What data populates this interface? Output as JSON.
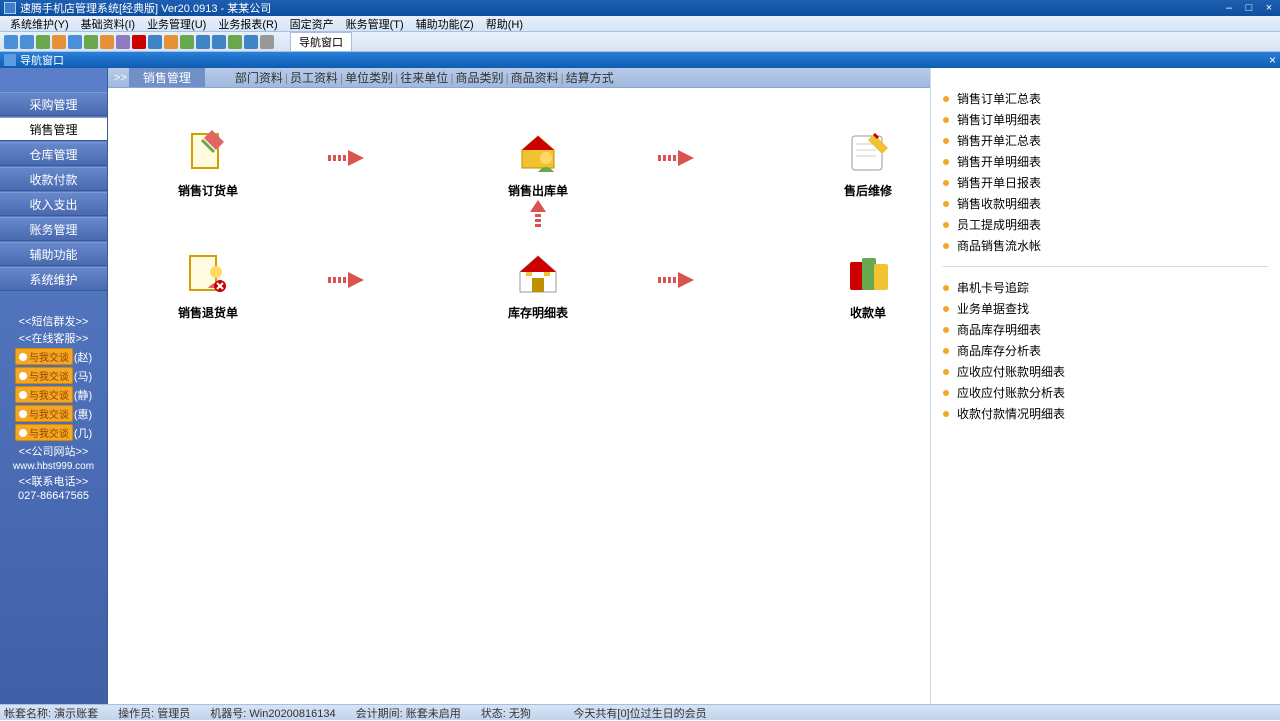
{
  "window": {
    "title": "速腾手机店管理系统[经典版] Ver20.0913  -  某某公司"
  },
  "menus": [
    "系统维护(Y)",
    "基础资料(I)",
    "业务管理(U)",
    "业务报表(R)",
    "固定资产",
    "账务管理(T)",
    "辅助功能(Z)",
    "帮助(H)"
  ],
  "toolbar_crumb": "导航窗口",
  "nav_header": "导航窗口",
  "sidebar": {
    "items": [
      "采购管理",
      "销售管理",
      "仓库管理",
      "收款付款",
      "收入支出",
      "账务管理",
      "辅助功能",
      "系统维护"
    ],
    "info": {
      "sms": "<<短信群发>>",
      "online": "<<在线客服>>",
      "chats": [
        "(赵)",
        "(马)",
        "(静)",
        "(惠)",
        "(几)"
      ],
      "chat_badge": "与我交谈",
      "website_title": "<<公司网站>>",
      "website": "www.hbst999.com",
      "phone_title": "<<联系电话>>",
      "phone": "027-86647565"
    }
  },
  "breadcrumb": {
    "title": "销售管理",
    "prefix": ">>",
    "links": [
      "部门资料",
      "员工资料",
      "单位类别",
      "往来单位",
      "商品类别",
      "商品资料",
      "结算方式"
    ]
  },
  "flow": {
    "row1": [
      "销售订货单",
      "销售出库单",
      "售后维修"
    ],
    "row2": [
      "销售退货单",
      "库存明细表",
      "收款单"
    ]
  },
  "right_panel": {
    "group1": [
      "销售订单汇总表",
      "销售订单明细表",
      "销售开单汇总表",
      "销售开单明细表",
      "销售开单日报表",
      "销售收款明细表",
      "员工提成明细表",
      "商品销售流水帐"
    ],
    "group2": [
      "串机卡号追踪",
      "业务单据查找",
      "商品库存明细表",
      "商品库存分析表",
      "应收应付账款明细表",
      "应收应付账款分析表",
      "收款付款情况明细表"
    ]
  },
  "status": {
    "account_label": "帐套名称:",
    "account": "演示账套",
    "operator_label": "操作员:",
    "operator": "管理员",
    "machine_label": "机器号:",
    "machine": "Win20200816134",
    "period_label": "会计期间:",
    "period": "账套未启用",
    "state_label": "状态:",
    "state": "无狗",
    "birthday": "今天共有[0]位过生日的会员"
  }
}
